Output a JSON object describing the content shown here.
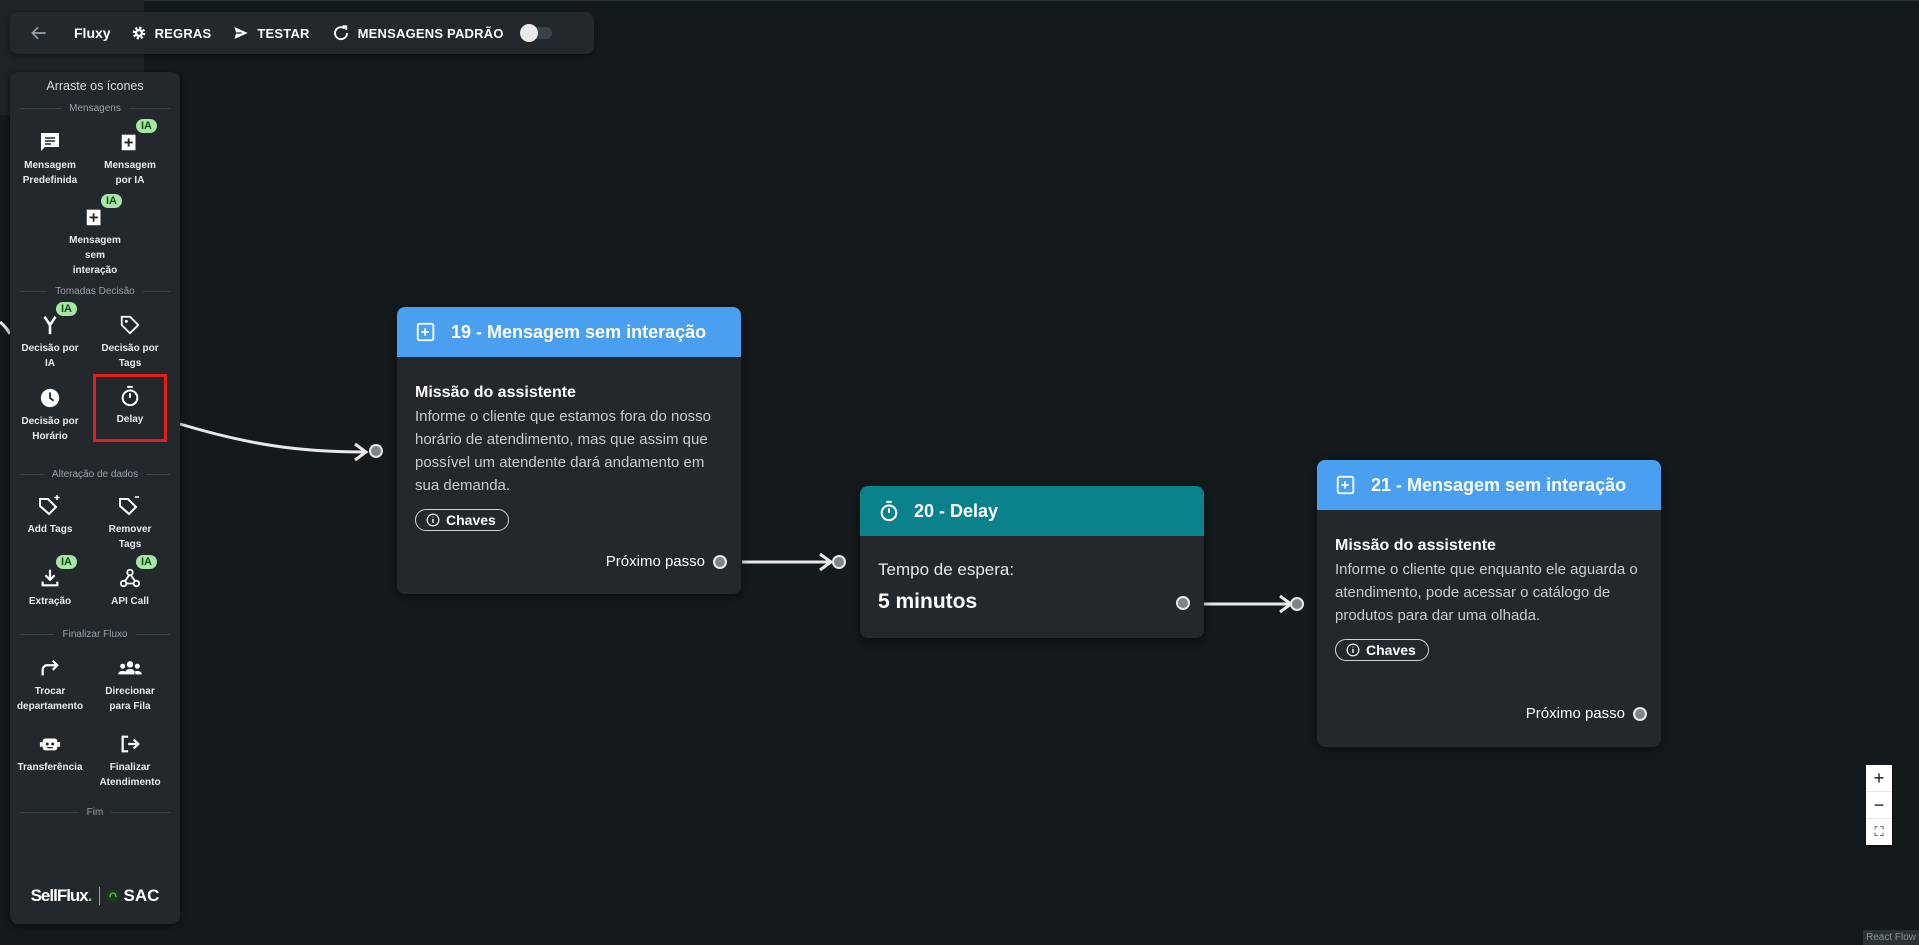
{
  "toolbar": {
    "title": "Fluxy",
    "rules_label": "REGRAS",
    "test_label": "TESTAR",
    "default_messages_label": "MENSAGENS PADRÃO"
  },
  "sidebar": {
    "header": "Arraste os ícones",
    "sections": {
      "messages": "Mensagens",
      "decisions": "Tomadas Decisão",
      "data": "Alteração de dados",
      "finish": "Finalizar Fluxo",
      "end": "Fim"
    },
    "items": {
      "predefined": "Mensagem Predefinida",
      "ai_message": "Mensagem por IA",
      "no_interaction": "Mensagem sem interação",
      "ai_decision": "Decisão por IA",
      "tags_decision": "Decisão por Tags",
      "time_decision": "Decisão por Horário",
      "delay": "Delay",
      "add_tags": "Add Tags",
      "remove_tags": "Remover Tags",
      "extraction": "Extração",
      "api_call": "API Call",
      "change_dept": "Trocar departamento",
      "queue": "Direcionar para Fila",
      "transfer": "Transferência",
      "finish_service": "Finalizar Atendimento"
    },
    "ia_badge": "IA",
    "logo": {
      "brand": "SellFlux",
      "dot": ".",
      "product": "SAC"
    }
  },
  "nodes": {
    "n19": {
      "title": "19 - Mensagem sem interação",
      "mission_title": "Missão do assistente",
      "mission_text": "Informe o cliente que estamos fora do nosso horário de atendimento, mas que assim que possível um atendente dará andamento em sua demanda.",
      "keys_label": "Chaves",
      "next_label": "Próximo passo"
    },
    "n20": {
      "title": "20 - Delay",
      "wait_label": "Tempo de espera:",
      "wait_value": "5 minutos"
    },
    "n21": {
      "title": "21 - Mensagem sem interação",
      "mission_title": "Missão do assistente",
      "mission_text": "Informe o cliente que enquanto ele aguarda o atendimento, pode acessar o catálogo de produtos para dar uma olhada.",
      "keys_label": "Chaves",
      "next_label": "Próximo passo"
    }
  },
  "controls": {
    "zoom_in": "+",
    "zoom_out": "−",
    "fit": "⛶"
  },
  "attribution": "React Flow",
  "colors": {
    "node_blue": "#4a9ff0",
    "node_teal": "#0b818c",
    "ia_badge": "#a8e6a3",
    "selection": "#e01f1f"
  }
}
